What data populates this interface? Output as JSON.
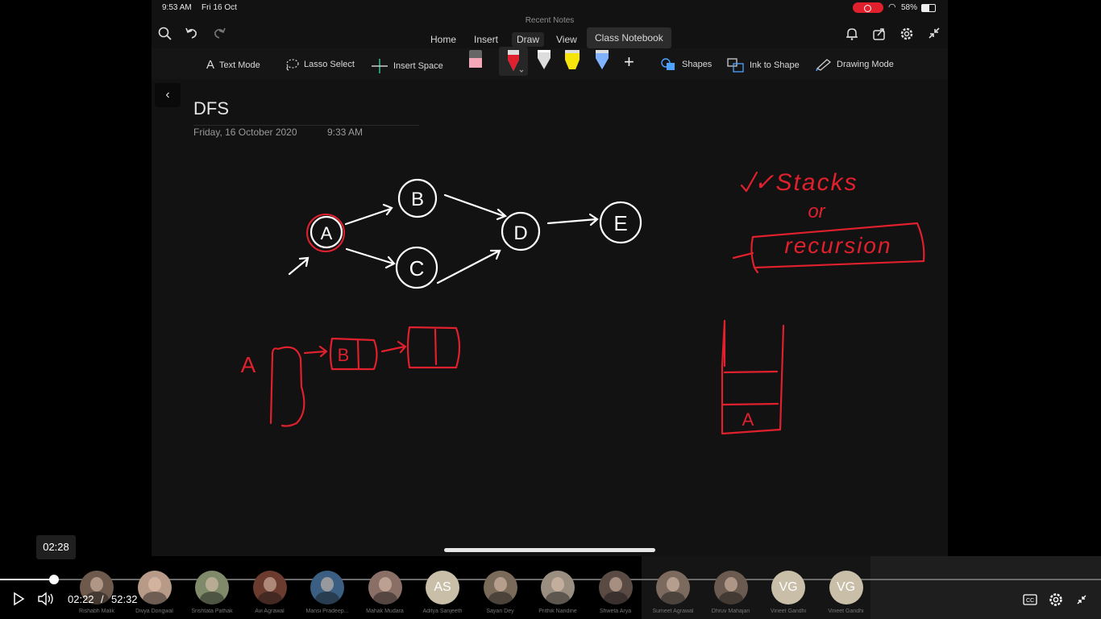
{
  "status": {
    "time": "9:53 AM",
    "date": "Fri 16 Oct",
    "battery": "58%"
  },
  "app": {
    "title": "Recent Notes",
    "tabs": [
      "Home",
      "Insert",
      "Draw",
      "View",
      "Class Notebook"
    ],
    "active_tab": "Draw"
  },
  "toolbar": {
    "text_mode": "Text Mode",
    "lasso_select": "Lasso Select",
    "insert_space": "Insert Space",
    "shapes": "Shapes",
    "ink_to_shape": "Ink to Shape",
    "drawing_mode": "Drawing Mode",
    "pens": [
      {
        "name": "eraser",
        "color": "#f4a7b9"
      },
      {
        "name": "red-pen",
        "color": "#e0202d"
      },
      {
        "name": "white-pen",
        "color": "#ffffff"
      },
      {
        "name": "yellow-highlighter",
        "color": "#f5e50a"
      },
      {
        "name": "blue-pen",
        "color": "#7fb2ff"
      }
    ]
  },
  "page": {
    "title": "DFS",
    "date": "Friday, 16 October 2020",
    "time": "9:33 AM"
  },
  "drawing": {
    "nodes": [
      "A",
      "B",
      "C",
      "D",
      "E"
    ],
    "notes": [
      "✓Stacks",
      "or",
      "recursion"
    ],
    "stack_item": "A",
    "chain_first": "A",
    "chain_second": "B"
  },
  "video": {
    "tooltip_time": "02:28",
    "current_time": "02:22",
    "separator": "/",
    "total_time": "52:32",
    "progress": 0.049
  },
  "participants": [
    {
      "name": "Rishabh Malik",
      "initials": ""
    },
    {
      "name": "Divya Dongwal",
      "initials": ""
    },
    {
      "name": "Srishtata Pathak",
      "initials": ""
    },
    {
      "name": "Avi Agrawal",
      "initials": ""
    },
    {
      "name": "Mansi Pradeep...",
      "initials": ""
    },
    {
      "name": "Mahak Mudara",
      "initials": ""
    },
    {
      "name": "Aditya Sanjeeth",
      "initials": "AS"
    },
    {
      "name": "Sayan Dey",
      "initials": ""
    },
    {
      "name": "Prithik Nandine",
      "initials": ""
    },
    {
      "name": "Shweta Arya",
      "initials": ""
    },
    {
      "name": "Sumeet Agrawal",
      "initials": ""
    },
    {
      "name": "Dhruv Mahajan",
      "initials": ""
    },
    {
      "name": "Vineet Gandhi",
      "initials": "VG"
    },
    {
      "name": "Vineet Gandhi",
      "initials": "VG"
    }
  ]
}
